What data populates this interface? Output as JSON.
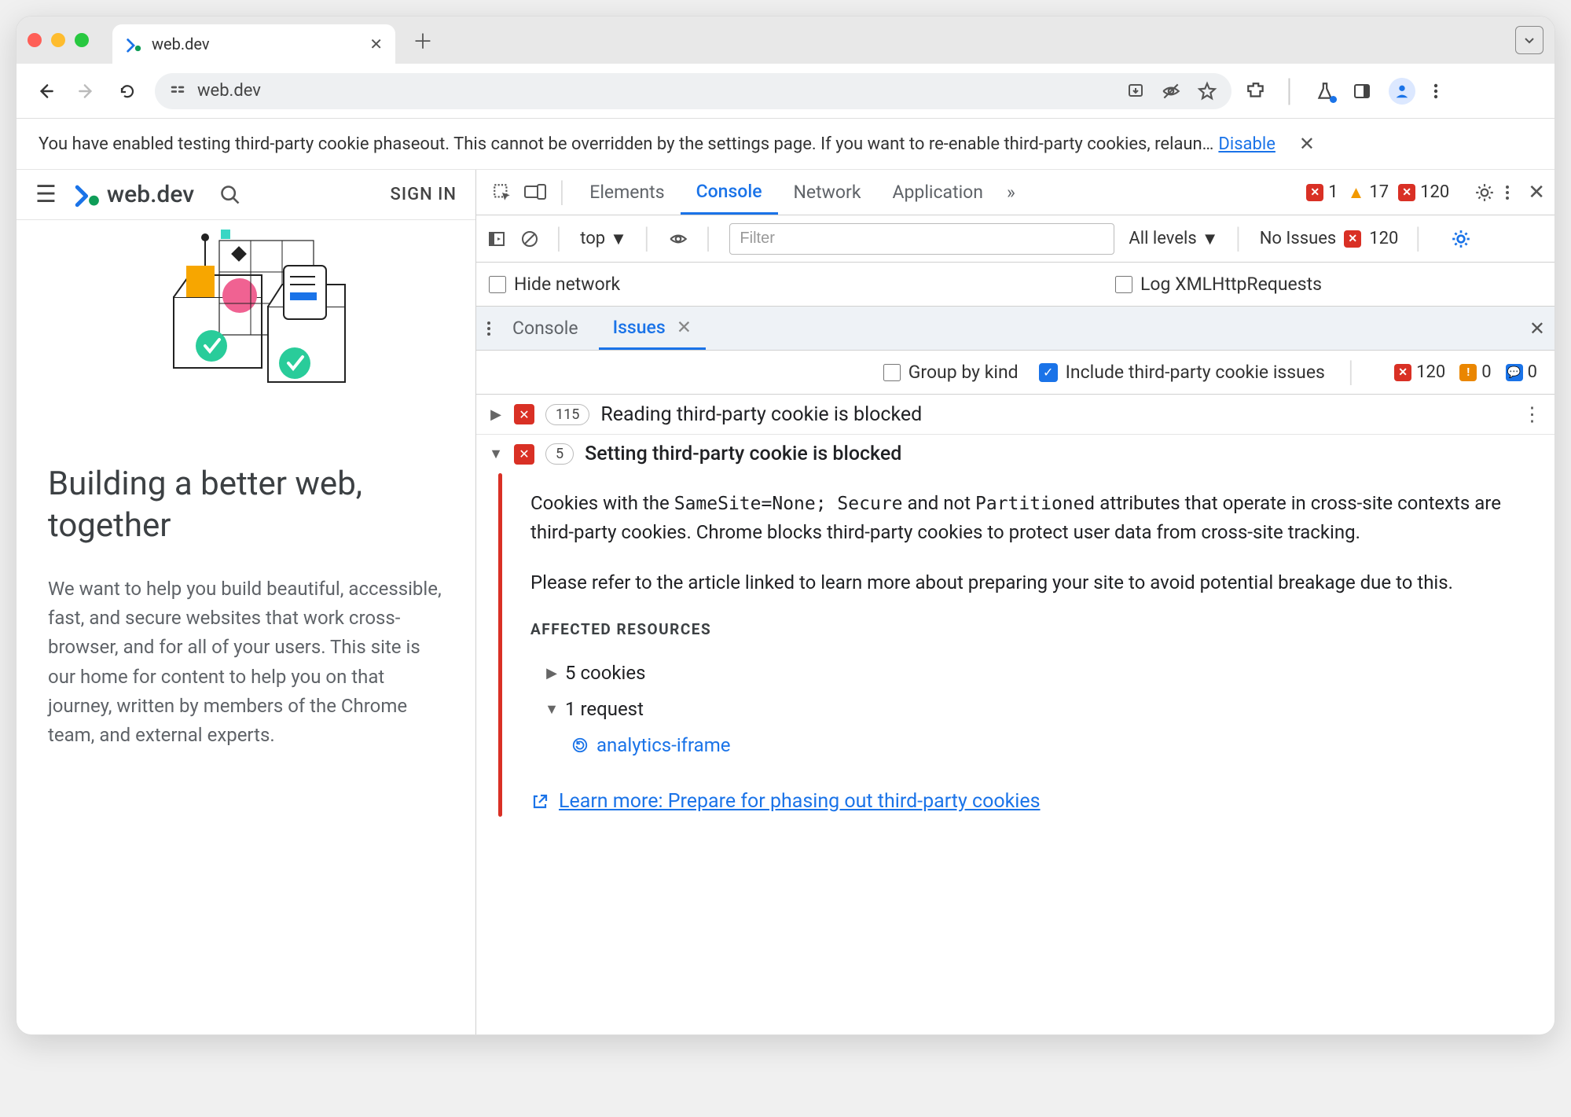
{
  "window": {
    "tab_title": "web.dev",
    "url_display": "web.dev"
  },
  "banner": {
    "text": "You have enabled testing third-party cookie phaseout. This cannot be overridden by the settings page. If you want to re-enable third-party cookies, relaun…",
    "link": "Disable"
  },
  "page": {
    "brand": "web.dev",
    "signin": "SIGN IN",
    "title": "Building a better web, together",
    "paragraph": "We want to help you build beautiful, accessible, fast, and secure websites that work cross-browser, and for all of your users. This site is our home for content to help you on that journey, written by members of the Chrome team, and external experts."
  },
  "devtools": {
    "tabs": [
      "Elements",
      "Console",
      "Network",
      "Application"
    ],
    "active_tab": "Console",
    "more_tabs_indicator": "»",
    "error_count": "1",
    "warning_count": "17",
    "blocked_count": "120",
    "console_bar": {
      "context": "top",
      "filter_placeholder": "Filter",
      "levels_label": "All levels",
      "no_issues_label": "No Issues",
      "no_issues_count": "120"
    },
    "options": {
      "hide_network": "Hide network",
      "log_xhr": "Log XMLHttpRequests"
    },
    "drawer": {
      "tabs": [
        "Console",
        "Issues"
      ],
      "active": "Issues",
      "group_by_kind": "Group by kind",
      "include_3p": "Include third-party cookie issues",
      "stats": {
        "red": "120",
        "orange": "0",
        "blue": "0"
      }
    },
    "issues": [
      {
        "count": "115",
        "title": "Reading third-party cookie is blocked",
        "expanded": false
      },
      {
        "count": "5",
        "title": "Setting third-party cookie is blocked",
        "expanded": true
      }
    ],
    "issue_detail": {
      "p1a": "Cookies with the ",
      "code1": "SameSite=None; Secure",
      "p1b": " and not ",
      "code2": "Partitioned",
      "p1c": " attributes that operate in cross-site contexts are third-party cookies. Chrome blocks third-party cookies to protect user data from cross-site tracking.",
      "p2": "Please refer to the article linked to learn more about preparing your site to avoid potential breakage due to this.",
      "affected_heading": "AFFECTED RESOURCES",
      "affected_cookies": "5 cookies",
      "affected_requests": "1 request",
      "request_name": "analytics-iframe",
      "learn_more": "Learn more: Prepare for phasing out third-party cookies"
    }
  }
}
